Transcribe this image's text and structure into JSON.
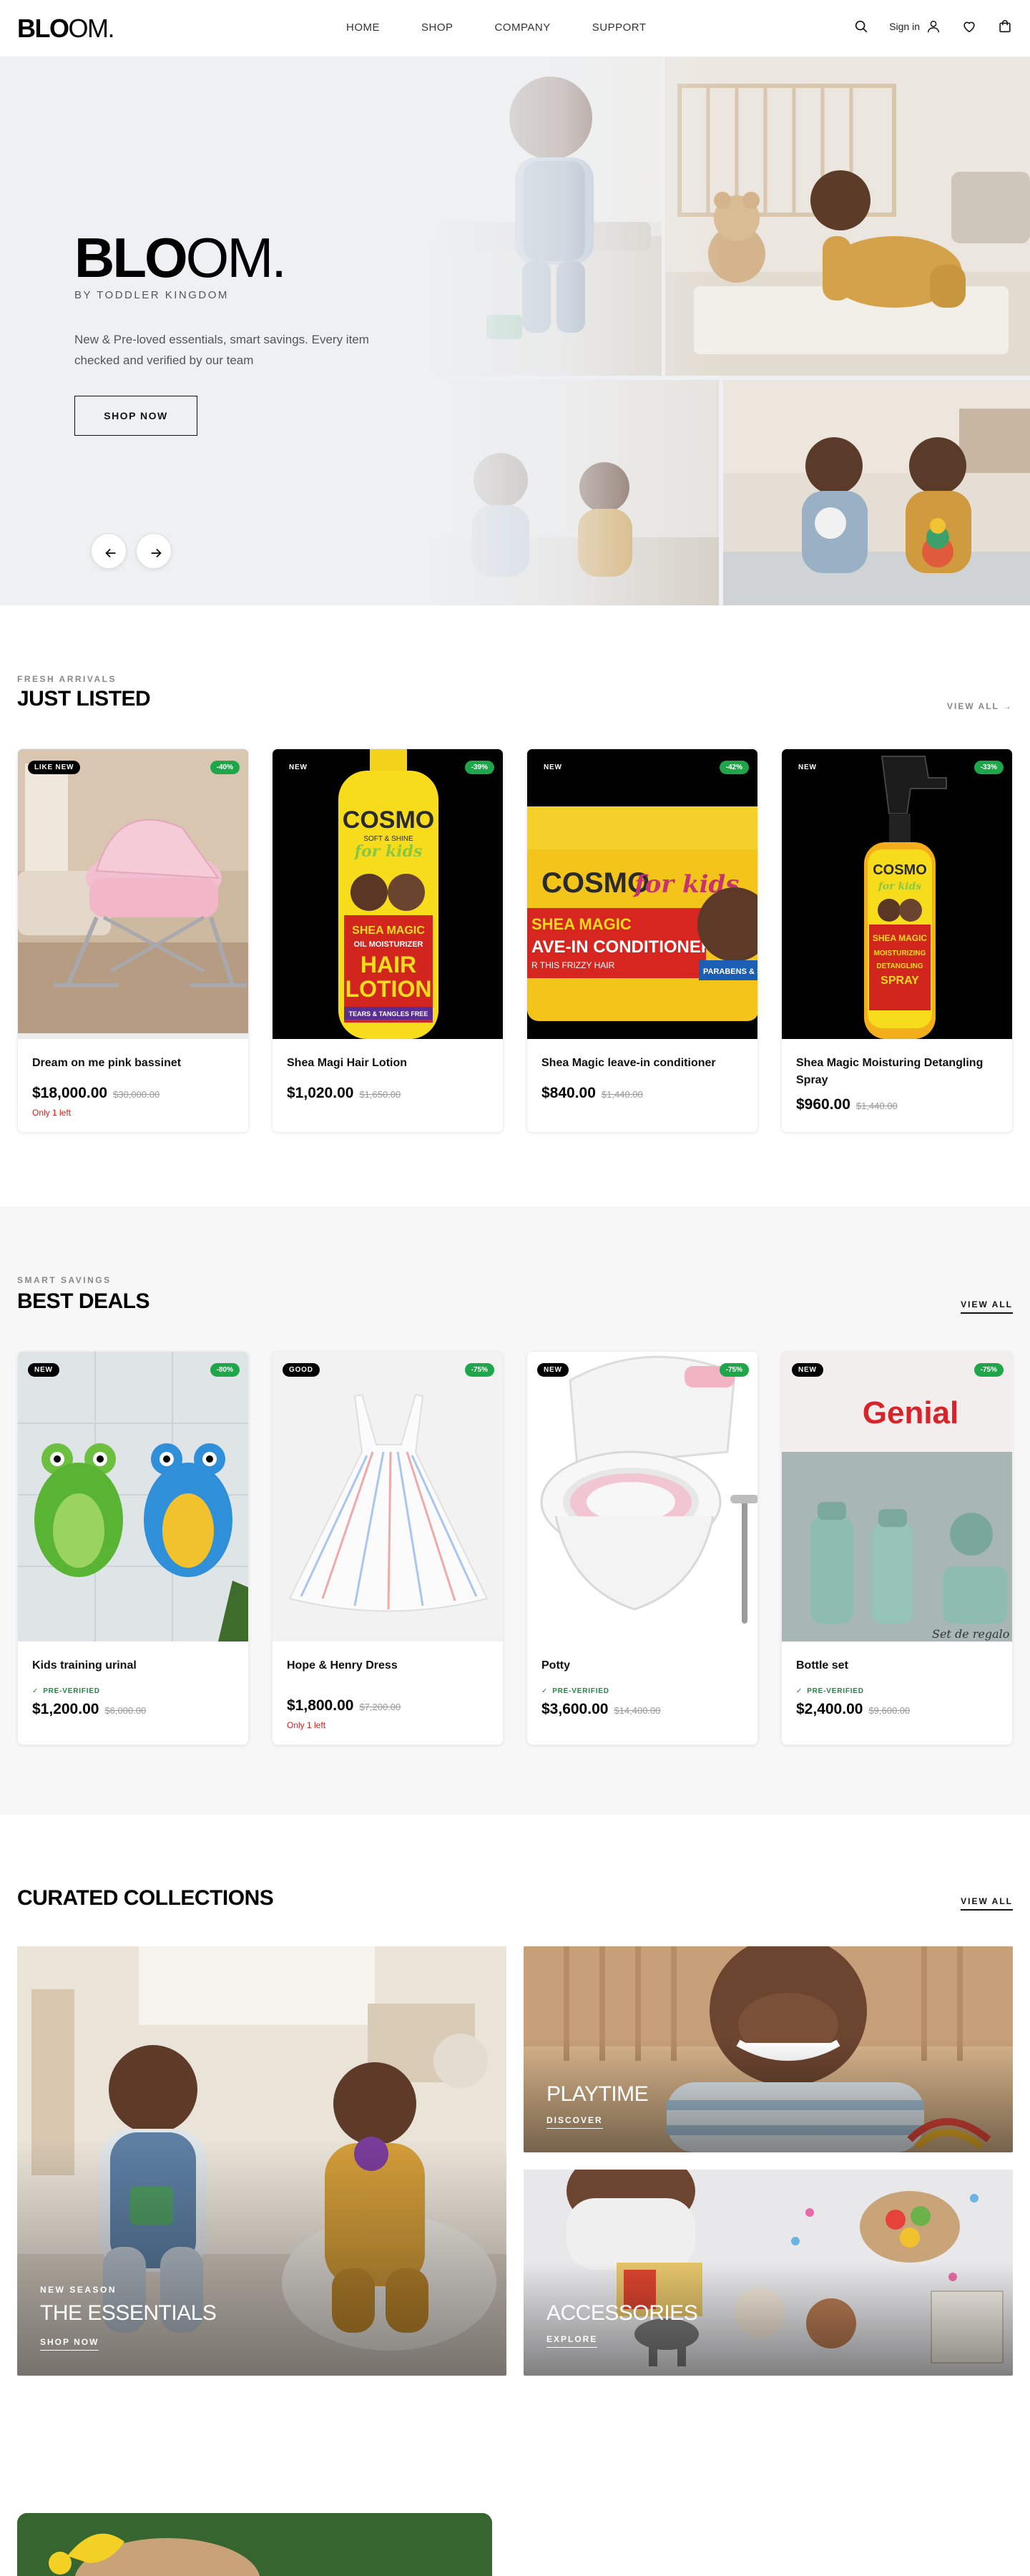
{
  "header": {
    "logo_bold": "BLO",
    "logo_light": "OM.",
    "nav": [
      "HOME",
      "SHOP",
      "COMPANY",
      "SUPPORT"
    ],
    "signin": "Sign in",
    "icons": [
      "search-icon",
      "user-icon",
      "heart-icon",
      "bag-icon"
    ]
  },
  "hero": {
    "title_bold": "BLO",
    "title_light": "OM.",
    "subtitle": "BY TODDLER KINGDOM",
    "description": "New & Pre-loved essentials, smart savings. Every item checked and verified by our team",
    "cta": "SHOP NOW"
  },
  "just_listed": {
    "eyebrow": "FRESH ARRIVALS",
    "title": "JUST LISTED",
    "view_all": "VIEW ALL →",
    "items": [
      {
        "badge": "LIKE NEW",
        "discount": "-40%",
        "name": "Dream on me pink bassinet",
        "price": "$18,000.00",
        "old_price": "$30,000.00",
        "stock": "Only 1 left"
      },
      {
        "badge": "NEW",
        "discount": "-39%",
        "name": "Shea Magi Hair Lotion",
        "price": "$1,020.00",
        "old_price": "$1,650.00",
        "stock": ""
      },
      {
        "badge": "NEW",
        "discount": "-42%",
        "name": "Shea Magic leave-in conditioner",
        "price": "$840.00",
        "old_price": "$1,440.00",
        "stock": ""
      },
      {
        "badge": "NEW",
        "discount": "-33%",
        "name": "Shea Magic Moisturing Detangling Spray",
        "price": "$960.00",
        "old_price": "$1,440.00",
        "stock": ""
      }
    ]
  },
  "best_deals": {
    "eyebrow": "SMART SAVINGS",
    "title": "BEST DEALS",
    "view_all": "VIEW ALL",
    "items": [
      {
        "badge": "NEW",
        "discount": "-80%",
        "name": "Kids training urinal",
        "verified": "PRE-VERIFIED",
        "price": "$1,200.00",
        "old_price": "$6,000.00",
        "stock": ""
      },
      {
        "badge": "GOOD",
        "discount": "-75%",
        "name": "Hope & Henry Dress",
        "verified": "",
        "price": "$1,800.00",
        "old_price": "$7,200.00",
        "stock": "Only 1 left"
      },
      {
        "badge": "NEW",
        "discount": "-75%",
        "name": "Potty",
        "verified": "PRE-VERIFIED",
        "price": "$3,600.00",
        "old_price": "$14,400.00",
        "stock": ""
      },
      {
        "badge": "NEW",
        "discount": "-75%",
        "name": "Bottle set",
        "verified": "PRE-VERIFIED",
        "price": "$2,400.00",
        "old_price": "$9,600.00",
        "stock": ""
      }
    ]
  },
  "collections": {
    "title": "CURATED COLLECTIONS",
    "view_all": "VIEW ALL",
    "items": [
      {
        "eyebrow": "NEW SEASON",
        "title": "THE ESSENTIALS",
        "link": "SHOP NOW"
      },
      {
        "eyebrow": "",
        "title": "PLAYTIME",
        "link": "DISCOVER"
      },
      {
        "eyebrow": "",
        "title": "ACCESSORIES",
        "link": "EXPLORE"
      }
    ]
  },
  "product_art": {
    "cosmo": "COSMO",
    "soft_shine": "SOFT & SHINE",
    "for_kids": "for kids",
    "lotion_1": "SHEA MAGIC",
    "lotion_2": "OIL MOISTURIZER",
    "lotion_3": "HAIR",
    "lotion_4": "LOTION",
    "lotion_5": "TEARS & TANGLES FREE",
    "cond_1": "SHEA MAGIC",
    "cond_2": "AVE-IN CONDITIONER",
    "cond_3": "R THIS FRIZZY HAIR",
    "cond_4": "PARABENS & S",
    "spray_1": "SHEA MAGIC",
    "spray_2": "MOISTURIZING",
    "spray_3": "DETANGLING",
    "spray_4": "SPRAY",
    "genial": "Genial",
    "genial_partial": "ial",
    "set_de_regalo": "Set de regalo /"
  }
}
